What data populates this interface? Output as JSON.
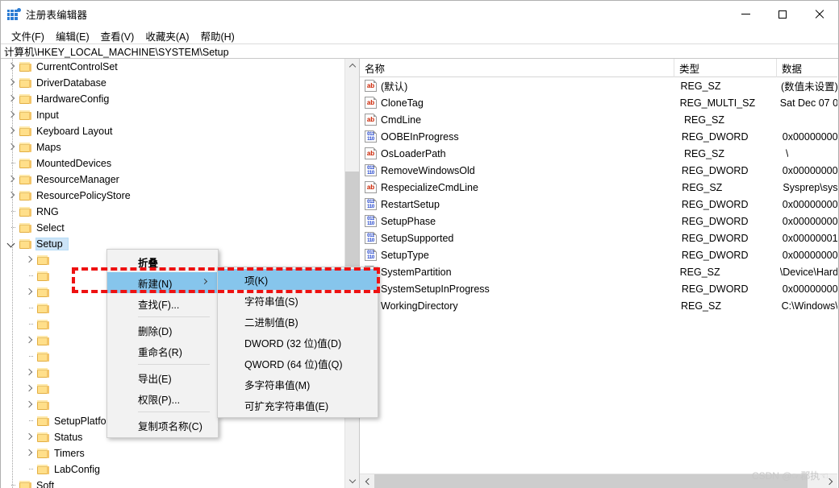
{
  "window": {
    "title": "注册表编辑器",
    "icon": "registry-icon",
    "minimize_label": "最小化",
    "maximize_label": "最大化",
    "close_label": "关闭"
  },
  "menubar": {
    "items": [
      {
        "label": "文件(F)",
        "name": "menu-file"
      },
      {
        "label": "编辑(E)",
        "name": "menu-edit"
      },
      {
        "label": "查看(V)",
        "name": "menu-view"
      },
      {
        "label": "收藏夹(A)",
        "name": "menu-favorites"
      },
      {
        "label": "帮助(H)",
        "name": "menu-help"
      }
    ]
  },
  "address": {
    "path": "计算机\\HKEY_LOCAL_MACHINE\\SYSTEM\\Setup"
  },
  "tree": {
    "items": [
      {
        "label": "CurrentControlSet",
        "twisty": "collapsed",
        "indent": 1,
        "selected": false
      },
      {
        "label": "DriverDatabase",
        "twisty": "collapsed",
        "indent": 1,
        "selected": false
      },
      {
        "label": "HardwareConfig",
        "twisty": "collapsed",
        "indent": 1,
        "selected": false
      },
      {
        "label": "Input",
        "twisty": "collapsed",
        "indent": 1,
        "selected": false
      },
      {
        "label": "Keyboard Layout",
        "twisty": "collapsed",
        "indent": 1,
        "selected": false
      },
      {
        "label": "Maps",
        "twisty": "collapsed",
        "indent": 1,
        "selected": false
      },
      {
        "label": "MountedDevices",
        "twisty": "none",
        "indent": 1,
        "selected": false
      },
      {
        "label": "ResourceManager",
        "twisty": "collapsed",
        "indent": 1,
        "selected": false
      },
      {
        "label": "ResourcePolicyStore",
        "twisty": "collapsed",
        "indent": 1,
        "selected": false
      },
      {
        "label": "RNG",
        "twisty": "none",
        "indent": 1,
        "selected": false
      },
      {
        "label": "Select",
        "twisty": "none",
        "indent": 1,
        "selected": false
      },
      {
        "label": "Setup",
        "twisty": "expanded",
        "indent": 1,
        "selected": true
      },
      {
        "label": "",
        "twisty": "collapsed",
        "indent": 2,
        "selected": false
      },
      {
        "label": "",
        "twisty": "none",
        "indent": 2,
        "selected": false
      },
      {
        "label": "",
        "twisty": "collapsed",
        "indent": 2,
        "selected": false
      },
      {
        "label": "",
        "twisty": "none",
        "indent": 2,
        "selected": false
      },
      {
        "label": "",
        "twisty": "none",
        "indent": 2,
        "selected": false
      },
      {
        "label": "",
        "twisty": "collapsed",
        "indent": 2,
        "selected": false
      },
      {
        "label": "",
        "twisty": "none",
        "indent": 2,
        "selected": false
      },
      {
        "label": "",
        "twisty": "collapsed",
        "indent": 2,
        "selected": false
      },
      {
        "label": "",
        "twisty": "collapsed",
        "indent": 2,
        "selected": false
      },
      {
        "label": "",
        "twisty": "collapsed",
        "indent": 2,
        "selected": false
      },
      {
        "label": "SetupPlatform",
        "twisty": "none",
        "indent": 2,
        "selected": false
      },
      {
        "label": "Status",
        "twisty": "collapsed",
        "indent": 2,
        "selected": false
      },
      {
        "label": "Timers",
        "twisty": "collapsed",
        "indent": 2,
        "selected": false
      },
      {
        "label": "LabConfig",
        "twisty": "none",
        "indent": 2,
        "selected": false
      },
      {
        "label": "Soft",
        "twisty": "none",
        "indent": 1,
        "selected": false
      }
    ]
  },
  "values": {
    "columns": [
      {
        "label": "名称",
        "name": "column-name"
      },
      {
        "label": "类型",
        "name": "column-type"
      },
      {
        "label": "数据",
        "name": "column-data"
      }
    ],
    "rows": [
      {
        "name": "(默认)",
        "type": "REG_SZ",
        "data": "(数值未设置)",
        "icon": "string-value-icon"
      },
      {
        "name": "CloneTag",
        "type": "REG_MULTI_SZ",
        "data": "Sat Dec 07 0",
        "icon": "string-value-icon"
      },
      {
        "name": "CmdLine",
        "type": "REG_SZ",
        "data": "",
        "icon": "string-value-icon"
      },
      {
        "name": "OOBEInProgress",
        "type": "REG_DWORD",
        "data": "0x00000000",
        "icon": "dword-value-icon"
      },
      {
        "name": "OsLoaderPath",
        "type": "REG_SZ",
        "data": "\\",
        "icon": "string-value-icon"
      },
      {
        "name": "RemoveWindowsOld",
        "type": "REG_DWORD",
        "data": "0x00000000",
        "icon": "dword-value-icon"
      },
      {
        "name": "RespecializeCmdLine",
        "type": "REG_SZ",
        "data": "Sysprep\\sys",
        "icon": "string-value-icon"
      },
      {
        "name": "RestartSetup",
        "type": "REG_DWORD",
        "data": "0x00000000",
        "icon": "dword-value-icon"
      },
      {
        "name": "SetupPhase",
        "type": "REG_DWORD",
        "data": "0x00000000",
        "icon": "dword-value-icon"
      },
      {
        "name": "SetupSupported",
        "type": "REG_DWORD",
        "data": "0x00000001",
        "icon": "dword-value-icon"
      },
      {
        "name": "SetupType",
        "type": "REG_DWORD",
        "data": "0x00000000",
        "icon": "dword-value-icon"
      },
      {
        "name": "SystemPartition",
        "type": "REG_SZ",
        "data": "\\Device\\Hard",
        "icon": "string-value-icon"
      },
      {
        "name": "SystemSetupInProgress",
        "type": "REG_DWORD",
        "data": "0x00000000",
        "icon": "dword-value-icon"
      },
      {
        "name": "WorkingDirectory",
        "type": "REG_SZ",
        "data": "C:\\Windows\\",
        "icon": "string-value-icon"
      }
    ]
  },
  "context_menu": {
    "items": [
      {
        "label": "折叠",
        "bold": true,
        "highlighted": false,
        "submenu": false,
        "name": "ctx-collapse"
      },
      {
        "label": "新建(N)",
        "bold": false,
        "highlighted": true,
        "submenu": true,
        "name": "ctx-new"
      },
      {
        "label": "查找(F)...",
        "bold": false,
        "highlighted": false,
        "submenu": false,
        "name": "ctx-find"
      },
      {
        "separator": true
      },
      {
        "label": "删除(D)",
        "bold": false,
        "highlighted": false,
        "submenu": false,
        "name": "ctx-delete"
      },
      {
        "label": "重命名(R)",
        "bold": false,
        "highlighted": false,
        "submenu": false,
        "name": "ctx-rename"
      },
      {
        "separator": true
      },
      {
        "label": "导出(E)",
        "bold": false,
        "highlighted": false,
        "submenu": false,
        "name": "ctx-export"
      },
      {
        "label": "权限(P)...",
        "bold": false,
        "highlighted": false,
        "submenu": false,
        "name": "ctx-permissions"
      },
      {
        "separator": true
      },
      {
        "label": "复制项名称(C)",
        "bold": false,
        "highlighted": false,
        "submenu": false,
        "name": "ctx-copy-key-name"
      }
    ]
  },
  "submenu": {
    "items": [
      {
        "label": "项(K)",
        "highlighted": true,
        "name": "submenu-key"
      },
      {
        "label": "字符串值(S)",
        "highlighted": false,
        "name": "submenu-string-value"
      },
      {
        "label": "二进制值(B)",
        "highlighted": false,
        "name": "submenu-binary-value"
      },
      {
        "label": "DWORD (32 位)值(D)",
        "highlighted": false,
        "name": "submenu-dword-value"
      },
      {
        "label": "QWORD (64 位)值(Q)",
        "highlighted": false,
        "name": "submenu-qword-value"
      },
      {
        "label": "多字符串值(M)",
        "highlighted": false,
        "name": "submenu-multi-string-value"
      },
      {
        "label": "可扩充字符串值(E)",
        "highlighted": false,
        "name": "submenu-expandable-string-value"
      }
    ]
  },
  "annotation": {
    "color": "#ee1111",
    "style": "dashed"
  },
  "watermark": {
    "text": "CSDN @☞郡执☜"
  }
}
